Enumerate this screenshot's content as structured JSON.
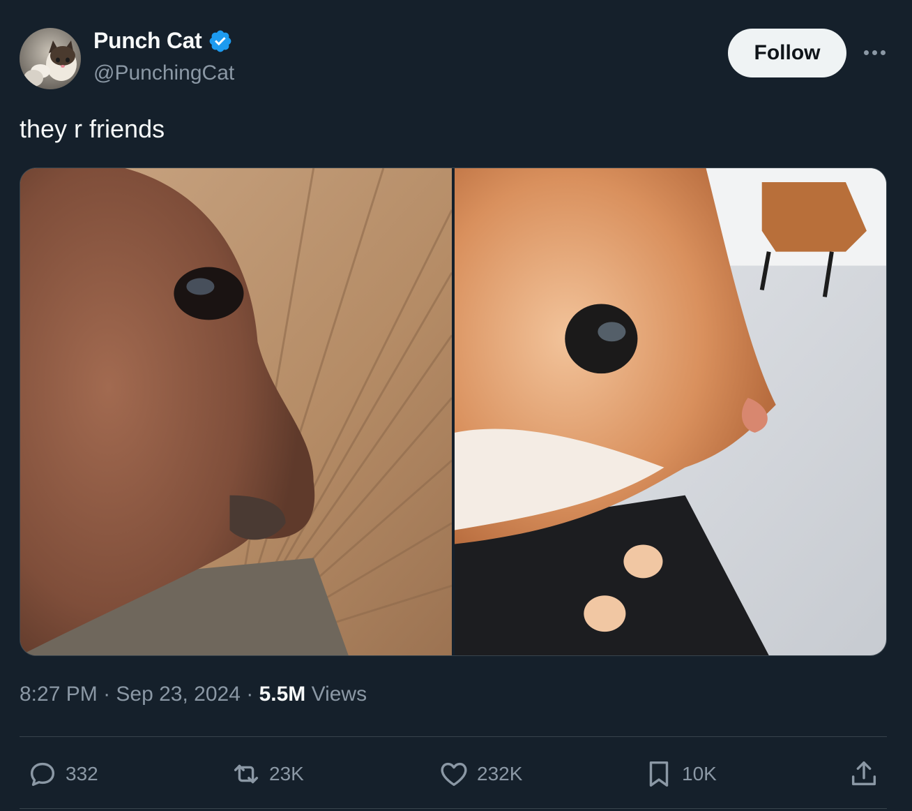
{
  "author": {
    "name": "Punch Cat",
    "handle": "@PunchingCat",
    "verified": true,
    "verified_color": "#1d9bf0",
    "avatar_icon": "cat-photo-avatar"
  },
  "header": {
    "follow_label": "Follow",
    "more_icon": "more-dots-icon"
  },
  "tweet": {
    "text": "they r friends",
    "media": [
      {
        "icon": "horse-face-photo"
      },
      {
        "icon": "orange-cat-photo"
      }
    ]
  },
  "meta": {
    "time": "8:27 PM",
    "separator1": " · ",
    "date": "Sep 23, 2024",
    "separator2": " · ",
    "views_count": "5.5M",
    "views_label": " Views"
  },
  "actions": {
    "replies": {
      "icon": "reply-icon",
      "count": "332"
    },
    "reposts": {
      "icon": "repost-icon",
      "count": "23K"
    },
    "likes": {
      "icon": "heart-icon",
      "count": "232K"
    },
    "bookmarks": {
      "icon": "bookmark-icon",
      "count": "10K"
    },
    "share": {
      "icon": "share-icon"
    }
  },
  "colors": {
    "background": "#15202b",
    "text_primary": "#f7f9f9",
    "text_secondary": "#8b98a5",
    "border": "#38444d"
  }
}
